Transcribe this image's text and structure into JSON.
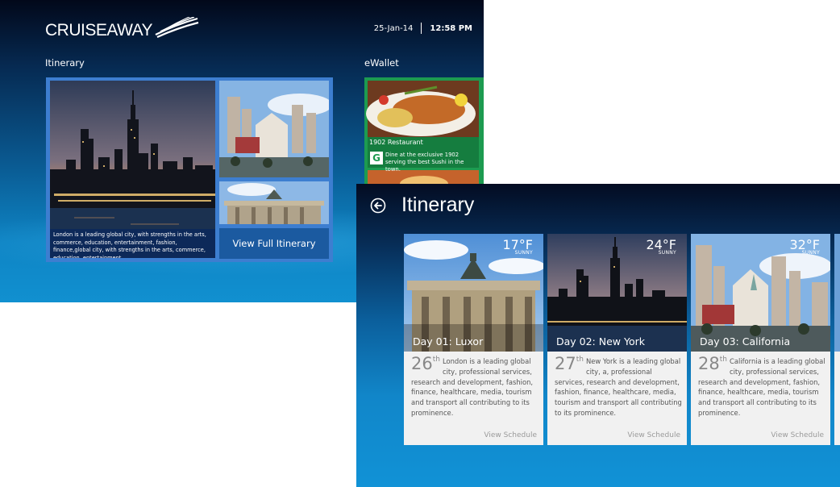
{
  "dashboard": {
    "brand": "CRUISEAWAY",
    "date": "25-Jan-14",
    "time": "12:58 PM",
    "itinerary_label": "Itinerary",
    "ewallet_label": "eWallet",
    "caption": "London is a leading global city, with strengths in the arts, commerce, education, entertainment, fashion, finance,global city, with strengths in the arts, commerce, education, entertainment.",
    "view_full_label": "View Full Itinerary",
    "ewallet_tile": {
      "title": "1902 Restaurant",
      "badge": "G",
      "text": "Dine at the exclusive 1902 serving the best Sushi in the town."
    }
  },
  "detail": {
    "title": "Itinerary",
    "cards": [
      {
        "temp": "17°F",
        "cond": "SUNNY",
        "day": "Day 01: Luxor",
        "date": "26",
        "suffix": "th",
        "text": "London is a leading global city, professional services, research and development, fashion, finance, healthcare, media, tourism and transport all contributing to its prominence.",
        "link": "View Schedule"
      },
      {
        "temp": "24°F",
        "cond": "SUNNY",
        "day": "Day 02: New York",
        "date": "27",
        "suffix": "th",
        "text": "New York is a leading global city, a, professional services, research and development, fashion, finance, healthcare, media, tourism and transport all contributing to its prominence.",
        "link": "View Schedule"
      },
      {
        "temp": "32°F",
        "cond": "SUNNY",
        "day": "Day 03: California",
        "date": "28",
        "suffix": "th",
        "text": "California is a leading global city, professional services, research and development, fashion, finance, healthcare, media, tourism and transport all contributing to its prominence.",
        "link": "View Schedule"
      }
    ]
  },
  "colors": {
    "tile_border": "#3d7ed0",
    "button": "#1b5aa0",
    "ewallet": "#1d9b50",
    "card_bg": "#f1f1f1"
  },
  "icons": [
    "ship-wave-logo-icon",
    "back-arrow-icon",
    "g-badge-icon"
  ]
}
